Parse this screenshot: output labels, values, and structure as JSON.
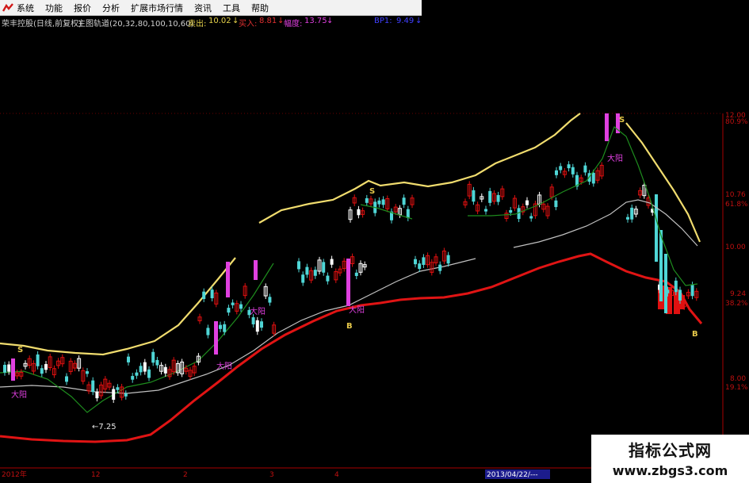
{
  "menu": {
    "items": [
      {
        "name": "menu-system",
        "label": "系统"
      },
      {
        "name": "menu-function",
        "label": "功能"
      },
      {
        "name": "menu-quote",
        "label": "报价"
      },
      {
        "name": "menu-analysis",
        "label": "分析"
      },
      {
        "name": "menu-extended-market",
        "label": "扩展市场行情"
      },
      {
        "name": "menu-news",
        "label": "资讯"
      },
      {
        "name": "menu-tools",
        "label": "工具"
      },
      {
        "name": "menu-help",
        "label": "帮助"
      }
    ]
  },
  "info_bar": {
    "stock_label": "荣丰控股(日线,前复权)",
    "indicator_label": "主图轨道(20,32,80,100,10,60)",
    "sell_label": "卖出:",
    "sell_value": "10.02",
    "buy_label": "买入:",
    "buy_value": "8.81",
    "range_label": "幅度:",
    "range_value": "13.75",
    "extra_label": "BP1:",
    "extra_value": "9.49"
  },
  "colors": {
    "upper_band": "#f0dc6e",
    "lower_band": "#e01414",
    "mid_line": "#c0c0c0",
    "ma_line": "#1e8c1e",
    "candle_up": "#e01010",
    "candle_down": "#4fd6d6",
    "candle_flat": "#ffffff",
    "signal_big": "#e040e0",
    "text_s": "#e6c84a",
    "axis_red": "#a80000",
    "sell_color": "#e6d24a",
    "buy_color": "#e03030",
    "range_color": "#e040e0",
    "extra_color": "#4040ff"
  },
  "price_axis": {
    "ticks": [
      {
        "label": "12.00"
      },
      {
        "label": "80.9%"
      },
      {
        "label": "10.76"
      },
      {
        "label": "61.8%"
      },
      {
        "label": "10.00"
      },
      {
        "label": "9.24"
      },
      {
        "label": "38.2%"
      },
      {
        "label": "8.00"
      },
      {
        "label": "19.1%"
      }
    ]
  },
  "time_axis": {
    "labels": [
      "2012年",
      "12",
      "2",
      "3",
      "4",
      "2013/04/22/---"
    ]
  },
  "annotations": {
    "signal_s": "S",
    "signal_b": "B",
    "big_yang": "大阳",
    "low_price": "←7.25"
  },
  "watermark": {
    "title": "指标公式网",
    "url": "www.zbgs3.com"
  }
}
